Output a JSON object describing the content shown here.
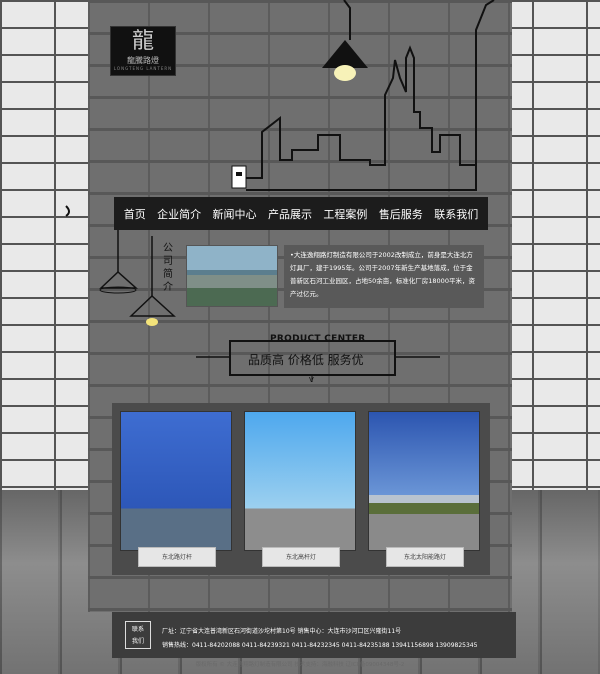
{
  "logo": {
    "mark": "龍",
    "cn": "龍騰路燈",
    "en": "LONGTENG LANTERN"
  },
  "nav": {
    "items": [
      "首页",
      "企业简介",
      "新闻中心",
      "产品展示",
      "工程案例",
      "售后服务",
      "联系我们"
    ]
  },
  "about": {
    "title": "公司简介",
    "text": "•大连逸翔路灯制造有限公司于2002改制成立，前身是大连北方灯具厂，建于1995年。公司于2007年新生产基地落成，位于金普新区石河工业园区，占地50余亩，标准化厂房18000平米，资产过亿元。"
  },
  "product_center": {
    "en": "PRODUCT CENTER",
    "cn": "品质高 价格低 服务优",
    "arrow": "V"
  },
  "products": [
    {
      "caption": "东北路灯杆"
    },
    {
      "caption": "东北高杆灯"
    },
    {
      "caption": "东北太阳能路灯"
    }
  ],
  "footer": {
    "contact_label_1": "联系",
    "contact_label_2": "我们",
    "row1": "厂址：辽宁省大连普湾新区石河街道沙坨村第10号       销售中心：大连市沙河口区兴隆街11号",
    "row2": "销售热线：0411-84202088    0411-84239321    0411-84232345    0411-84235188    13941156898    13909825345"
  },
  "copyright": "版权所有 © 大连逸翔路灯制造有限公司 技术支持：海融科技 辽ICP备09004348号-2"
}
